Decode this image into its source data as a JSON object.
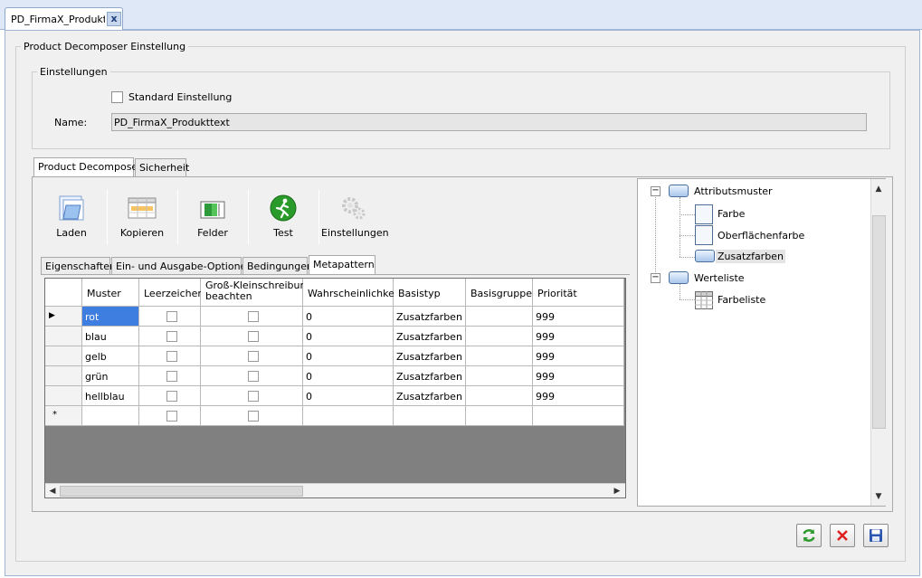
{
  "document_tab": {
    "title": "PD_FirmaX_Produktte",
    "close_label": "x"
  },
  "main_group": {
    "legend": "Product Decomposer Einstellung"
  },
  "settings_group": {
    "legend": "Einstellungen",
    "checkbox_label": "Standard Einstellung",
    "name_label": "Name:",
    "name_value": "PD_FirmaX_Produkttext"
  },
  "tabs": [
    {
      "label": "Product Decomposer",
      "active": true
    },
    {
      "label": "Sicherheit",
      "active": false
    }
  ],
  "toolbar": {
    "load_label": "Laden",
    "copy_label": "Kopieren",
    "fields_label": "Felder",
    "test_label": "Test",
    "settings_label": "Einstellungen"
  },
  "subtabs": [
    {
      "label": "Eigenschaften",
      "active": false
    },
    {
      "label": "Ein- und Ausgabe-Optionen",
      "active": false
    },
    {
      "label": "Bedingungen",
      "active": false
    },
    {
      "label": "Metapattern",
      "active": true
    }
  ],
  "grid": {
    "columns": {
      "muster": "Muster",
      "leerzeichen": "Leerzeichen",
      "gross_line1": "Groß-Kleinschreibung",
      "gross_line2": "beachten",
      "wahrscheinlichkeit": "Wahrscheinlichkeit",
      "basistyp": "Basistyp",
      "basisgruppe": "Basisgruppe",
      "prioritaet": "Priorität"
    },
    "rows": [
      {
        "muster": "rot",
        "wahrscheinlichkeit": "0",
        "basistyp": "Zusatzfarben",
        "basisgruppe": "",
        "prioritaet": "999"
      },
      {
        "muster": "blau",
        "wahrscheinlichkeit": "0",
        "basistyp": "Zusatzfarben",
        "basisgruppe": "",
        "prioritaet": "999"
      },
      {
        "muster": "gelb",
        "wahrscheinlichkeit": "0",
        "basistyp": "Zusatzfarben",
        "basisgruppe": "",
        "prioritaet": "999"
      },
      {
        "muster": "grün",
        "wahrscheinlichkeit": "0",
        "basistyp": "Zusatzfarben",
        "basisgruppe": "",
        "prioritaet": "999"
      },
      {
        "muster": "hellblau",
        "wahrscheinlichkeit": "0",
        "basistyp": "Zusatzfarben",
        "basisgruppe": "",
        "prioritaet": "999"
      }
    ],
    "current_row_marker": "▶",
    "new_row_marker": "*"
  },
  "tree": {
    "attributsmuster": "Attributsmuster",
    "farbe": "Farbe",
    "oberflaechenfarbe": "Oberflächenfarbe",
    "zusatzfarben": "Zusatzfarben",
    "werteliste": "Werteliste",
    "farbeliste": "Farbeliste"
  },
  "icons": {
    "refresh": "refresh-icon",
    "cancel": "cancel-icon",
    "save": "save-icon"
  }
}
